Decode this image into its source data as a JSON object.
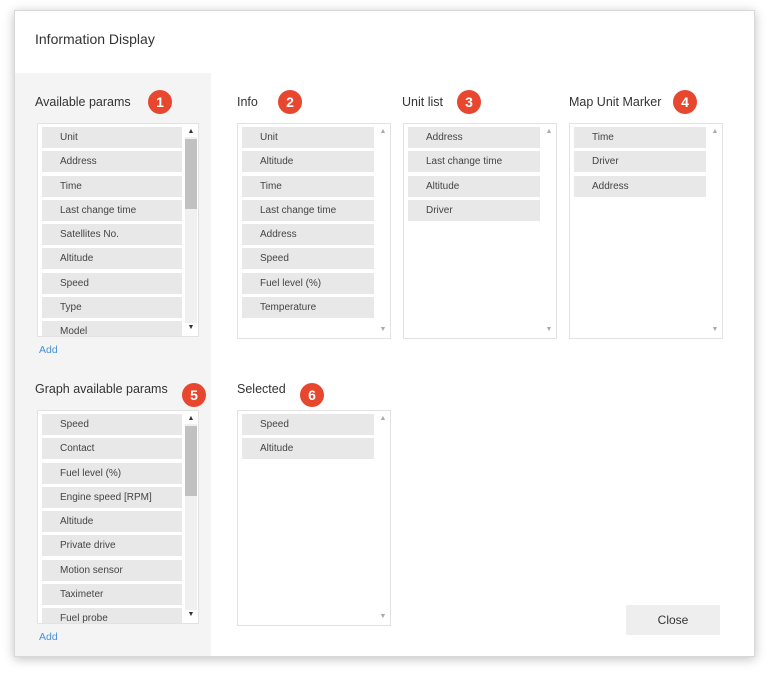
{
  "dialog": {
    "title": "Information Display",
    "close_label": "Close"
  },
  "accent_color": "#e8472f",
  "link_color": "#4a90d9",
  "sections": {
    "available_params": {
      "label": "Available params",
      "badge": "1",
      "add_label": "Add",
      "items": [
        "Unit",
        "Address",
        "Time",
        "Last change time",
        "Satellites No.",
        "Altitude",
        "Speed",
        "Type",
        "Model"
      ]
    },
    "info": {
      "label": "Info",
      "badge": "2",
      "items": [
        "Unit",
        "Altitude",
        "Time",
        "Last change time",
        "Address",
        "Speed",
        "Fuel level (%)",
        "Temperature"
      ]
    },
    "unit_list": {
      "label": "Unit list",
      "badge": "3",
      "items": [
        "Address",
        "Last change time",
        "Altitude",
        "Driver"
      ]
    },
    "map_unit_marker": {
      "label": "Map Unit Marker",
      "badge": "4",
      "items": [
        "Time",
        "Driver",
        "Address"
      ]
    },
    "graph_available_params": {
      "label": "Graph available params",
      "badge": "5",
      "add_label": "Add",
      "items": [
        "Speed",
        "Contact",
        "Fuel level (%)",
        "Engine speed [RPM]",
        "Altitude",
        "Private drive",
        "Motion sensor",
        "Taximeter",
        "Fuel probe"
      ]
    },
    "selected": {
      "label": "Selected",
      "badge": "6",
      "items": [
        "Speed",
        "Altitude"
      ]
    }
  }
}
